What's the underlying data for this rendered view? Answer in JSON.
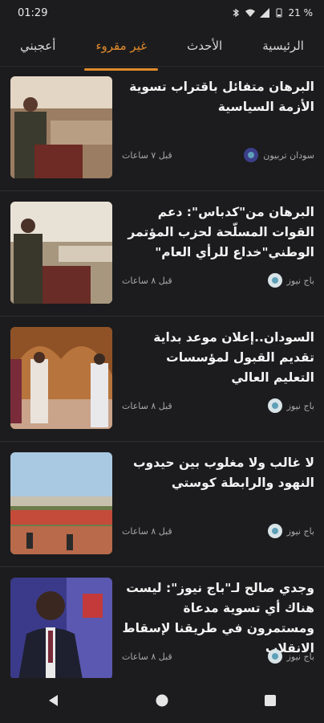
{
  "status": {
    "time": "01:29",
    "battery": "21 %"
  },
  "tabs": [
    {
      "label": "الرئيسية"
    },
    {
      "label": "الأحدث"
    },
    {
      "label": "غير مقروء"
    },
    {
      "label": "أعجبني"
    }
  ],
  "active_tab": "غير مقروء",
  "articles": [
    {
      "title": "البرهان متفائل باقتراب تسوية الأزمة السياسية",
      "source": "سودان تربيون",
      "time": "قبل ٧ ساعات"
    },
    {
      "title": "البرهان من\"كدباس\": دعم القوات المسلّحة لحزب المؤتمر الوطني\"خداع للرأي العام\"",
      "source": "باج نيوز",
      "time": "قبل ٨ ساعات"
    },
    {
      "title": "السودان..إعلان موعد بداية تقديم القبول لمؤسسات التعليم العالي",
      "source": "باج نيوز",
      "time": "قبل ٨ ساعات"
    },
    {
      "title": "لا غالب ولا مغلوب بين حيدوب النهود والرابطة كوستي",
      "source": "باج نيوز",
      "time": "قبل ٨ ساعات"
    },
    {
      "title": "وجدي صالح لـ\"باج نيوز\": ليست هناك أي تسوية مدعاة ومستمرون في طريقنا لإسقاط الانقلاب",
      "source": "باج نيوز",
      "time": "قبل ٨ ساعات"
    }
  ],
  "colors": {
    "accent": "#e08a2a",
    "background": "#1c1c1e"
  }
}
